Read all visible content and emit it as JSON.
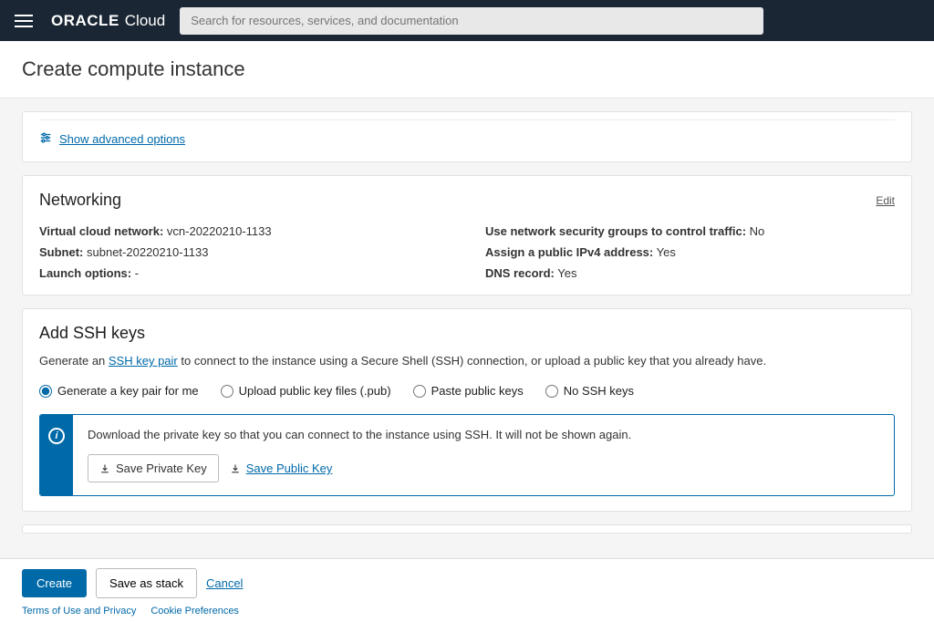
{
  "header": {
    "brand_oracle": "ORACLE",
    "brand_cloud": "Cloud",
    "search_placeholder": "Search for resources, services, and documentation"
  },
  "page": {
    "title": "Create compute instance"
  },
  "advanced": {
    "link": "Show advanced options"
  },
  "networking": {
    "title": "Networking",
    "edit": "Edit",
    "vcn_label": "Virtual cloud network:",
    "vcn_value": "vcn-20220210-1133",
    "subnet_label": "Subnet:",
    "subnet_value": "subnet-20220210-1133",
    "launch_label": "Launch options:",
    "launch_value": "-",
    "nsg_label": "Use network security groups to control traffic:",
    "nsg_value": "No",
    "pubip_label": "Assign a public IPv4 address:",
    "pubip_value": "Yes",
    "dns_label": "DNS record:",
    "dns_value": "Yes"
  },
  "ssh": {
    "title": "Add SSH keys",
    "desc_pre": "Generate an ",
    "desc_link": "SSH key pair",
    "desc_post": " to connect to the instance using a Secure Shell (SSH) connection, or upload a public key that you already have.",
    "opt1": "Generate a key pair for me",
    "opt2": "Upload public key files (.pub)",
    "opt3": "Paste public keys",
    "opt4": "No SSH keys",
    "info_text": "Download the private key so that you can connect to the instance using SSH. It will not be shown again.",
    "save_private": "Save Private Key",
    "save_public": "Save Public Key"
  },
  "footer": {
    "create": "Create",
    "save_stack": "Save as stack",
    "cancel": "Cancel",
    "terms": "Terms of Use and Privacy",
    "cookies": "Cookie Preferences"
  }
}
